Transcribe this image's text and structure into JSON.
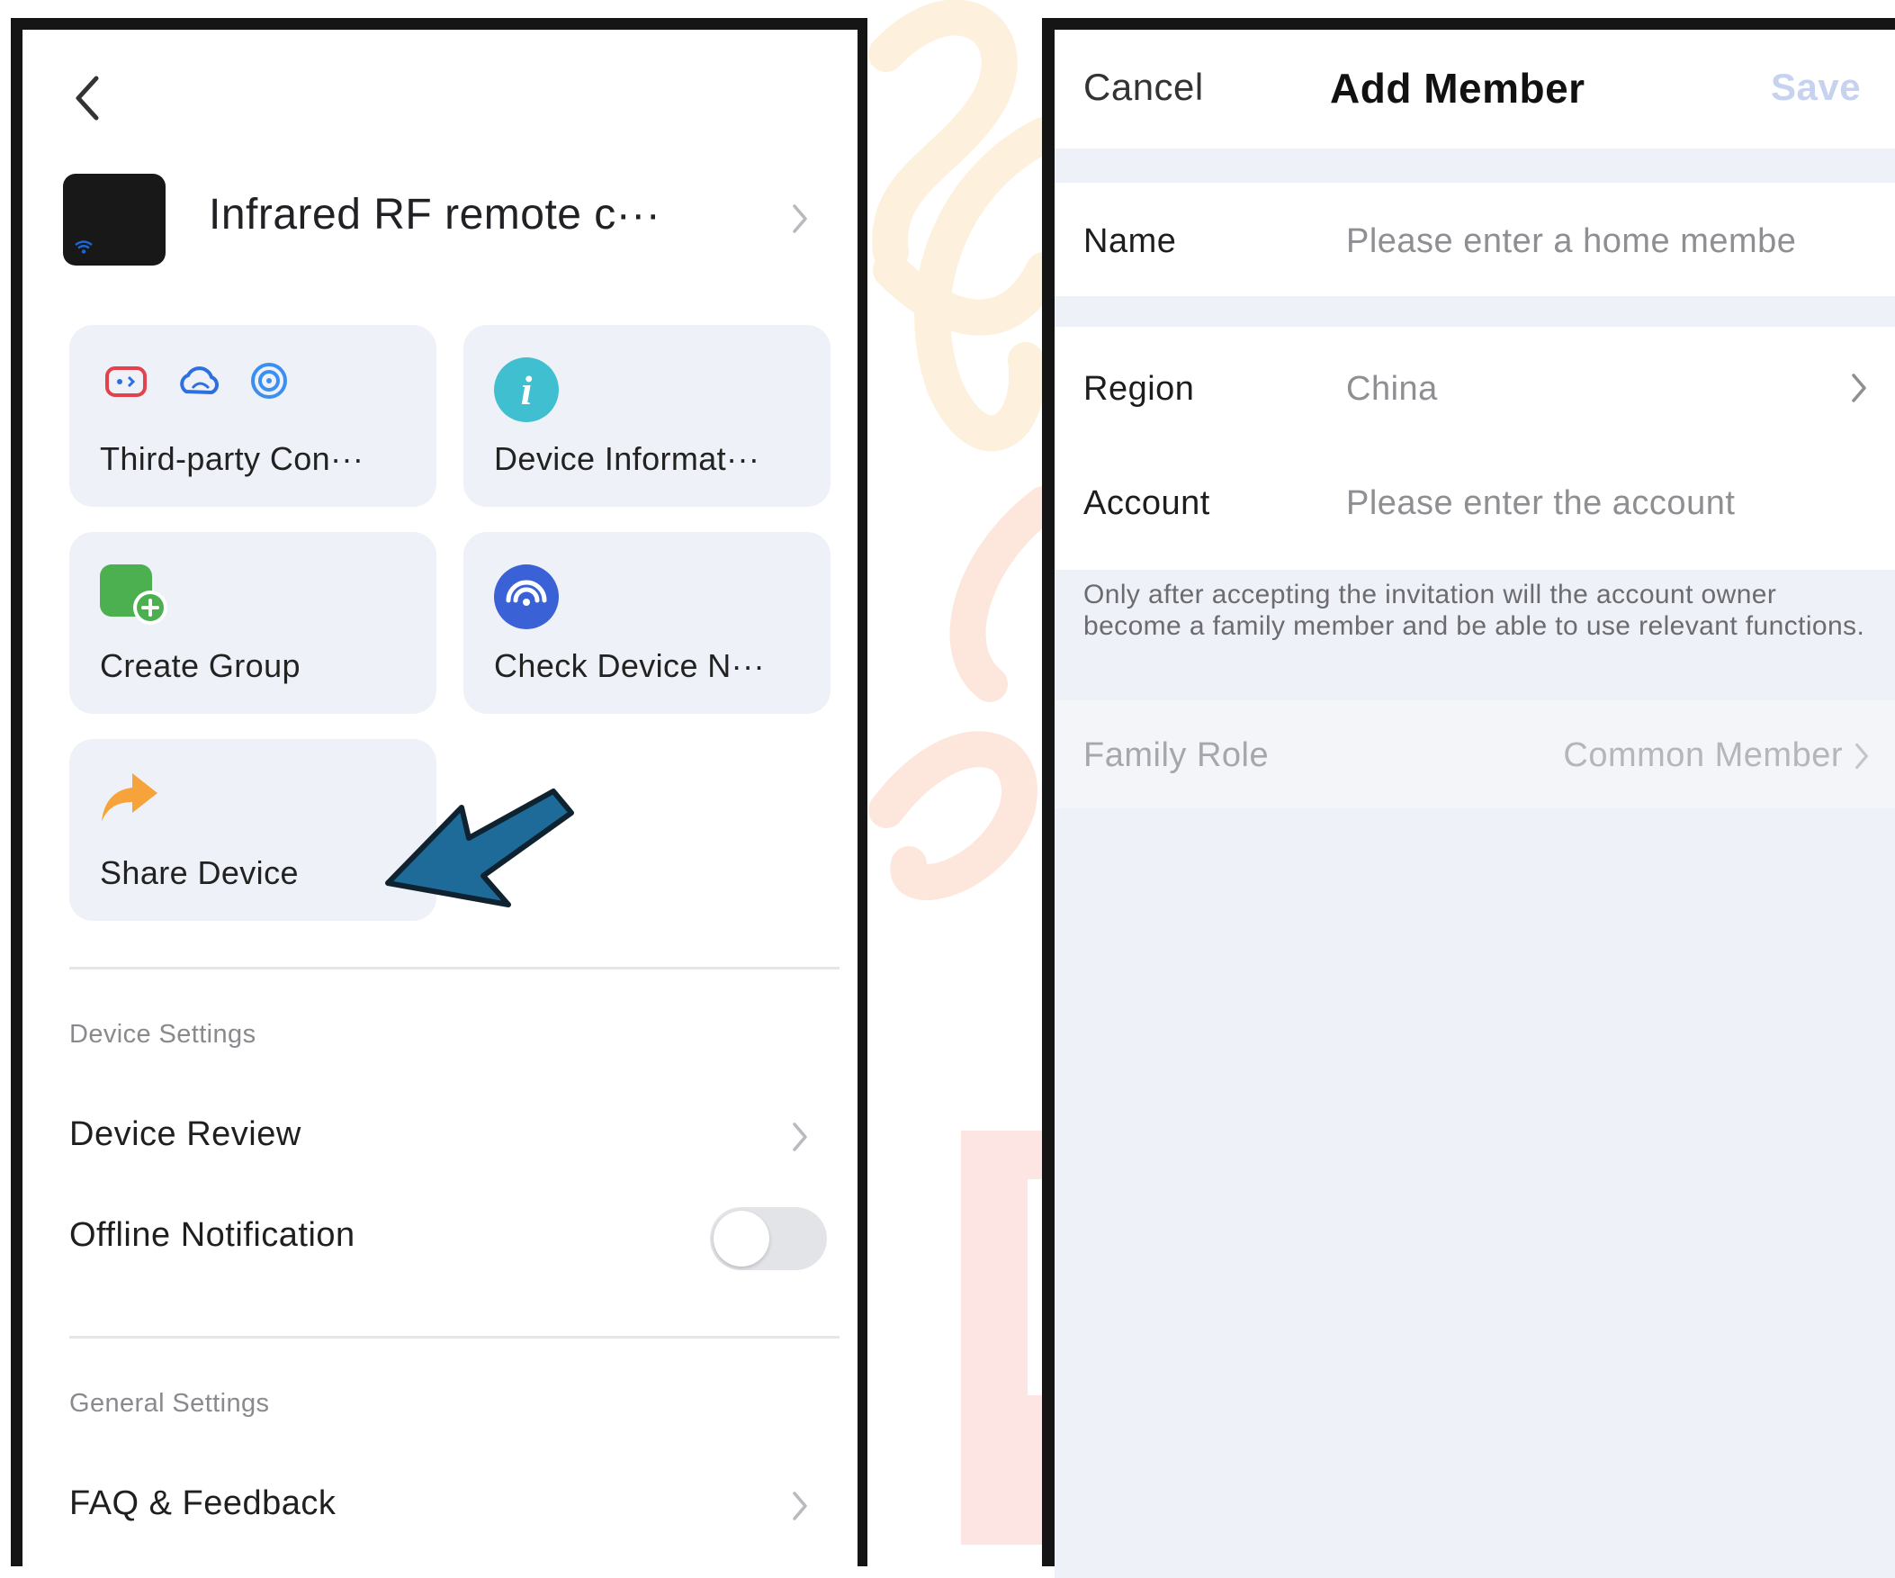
{
  "left_screen": {
    "device_name": "Infrared RF remote c···",
    "tiles": [
      {
        "label": "Third-party Con···",
        "icon": "third-party-services-icons"
      },
      {
        "label": "Device Informat···",
        "icon": "info-icon"
      },
      {
        "label": "Create Group",
        "icon": "create-group-icon"
      },
      {
        "label": "Check Device N···",
        "icon": "network-check-icon"
      },
      {
        "label": "Share Device",
        "icon": "share-arrow-icon"
      }
    ],
    "device_settings": {
      "heading": "Device Settings",
      "items": [
        {
          "label": "Device Review"
        },
        {
          "label": "Offline Notification",
          "toggle_on": false
        }
      ]
    },
    "general_settings": {
      "heading": "General Settings",
      "items": [
        {
          "label": "FAQ & Feedback"
        }
      ]
    }
  },
  "right_screen": {
    "nav": {
      "cancel": "Cancel",
      "title": "Add Member",
      "save": "Save"
    },
    "form": {
      "name": {
        "label": "Name",
        "placeholder": "Please enter a home membe"
      },
      "region": {
        "label": "Region",
        "value": "China"
      },
      "account": {
        "label": "Account",
        "placeholder": "Please enter the account"
      }
    },
    "note": "Only after accepting the invitation will the account owner become a family member and be able to use relevant functions.",
    "family_role": {
      "label": "Family Role",
      "value": "Common Member"
    }
  },
  "colors": {
    "tile_bg": "#eef1f7",
    "toggle_off": "#e3e4e8",
    "save_disabled": "#c7d3ee",
    "page_bg_right": "#eff1f8",
    "annotation_arrow": "#1e6b99"
  }
}
